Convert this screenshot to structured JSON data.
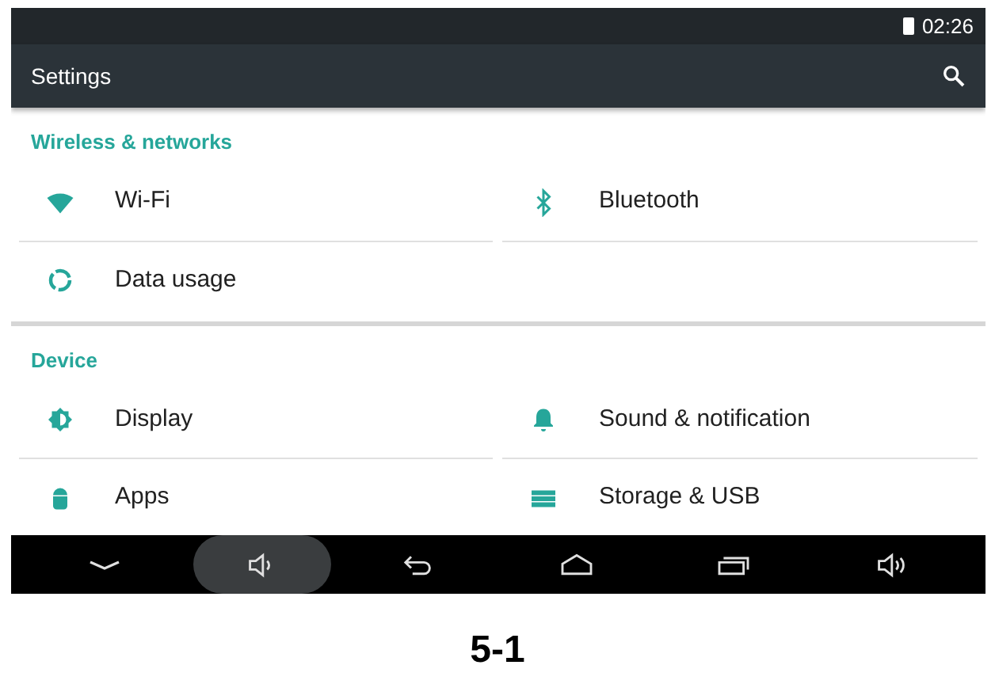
{
  "status_bar": {
    "time": "02:26"
  },
  "toolbar": {
    "title": "Settings"
  },
  "sections": [
    {
      "title": "Wireless & networks",
      "tiles": [
        {
          "label": "Wi-Fi",
          "kind": "wifi"
        },
        {
          "label": "Bluetooth",
          "kind": "bluetooth"
        },
        {
          "label": "Data usage",
          "kind": "data"
        }
      ]
    },
    {
      "title": "Device",
      "tiles": [
        {
          "label": "Display",
          "kind": "display"
        },
        {
          "label": "Sound & notification",
          "kind": "bell"
        },
        {
          "label": "Apps",
          "kind": "android"
        },
        {
          "label": "Storage & USB",
          "kind": "storage"
        }
      ]
    }
  ],
  "nav_bar": [
    {
      "kind": "hide",
      "selected": false
    },
    {
      "kind": "volume_down",
      "selected": true
    },
    {
      "kind": "back",
      "selected": false
    },
    {
      "kind": "home",
      "selected": false
    },
    {
      "kind": "recents",
      "selected": false
    },
    {
      "kind": "volume_up",
      "selected": false
    }
  ],
  "caption": "5-1"
}
